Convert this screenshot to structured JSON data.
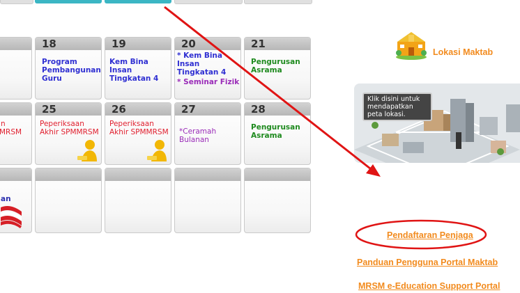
{
  "calendar": {
    "week1": [
      {
        "day": "18",
        "events": [
          "Program Pembangunan Guru"
        ]
      },
      {
        "day": "19",
        "events": [
          "Kem Bina Insan Tingkatan 4"
        ]
      },
      {
        "day": "20",
        "events": [
          "* Kem Bina Insan Tingkatan 4",
          "* Seminar Fizik"
        ]
      },
      {
        "day": "21",
        "events": [
          "Pengurusan Asrama"
        ]
      }
    ],
    "week2": [
      {
        "day": "",
        "events": [
          "n",
          "MRSM"
        ]
      },
      {
        "day": "25",
        "events": [
          "Peperiksaan Akhir SPMMRSM"
        ]
      },
      {
        "day": "26",
        "events": [
          "Peperiksaan Akhir SPMMRSM"
        ]
      },
      {
        "day": "27",
        "events": [
          "*Ceramah Bulanan"
        ]
      },
      {
        "day": "28",
        "events": [
          "Pengurusan Asrama"
        ]
      }
    ],
    "week3_partial_label": "an"
  },
  "sidebar": {
    "lokasi_label": "Lokasi Maktab",
    "map_caption": "Klik disini untuk mendapatkan peta lokasi.",
    "links": [
      "Pendaftaran Penjaga",
      "Panduan Pengguna Portal Maktab",
      "MRSM e-Education Support Portal"
    ]
  },
  "colors": {
    "annotation_red": "#e01414",
    "link_orange": "#f28b1e"
  }
}
